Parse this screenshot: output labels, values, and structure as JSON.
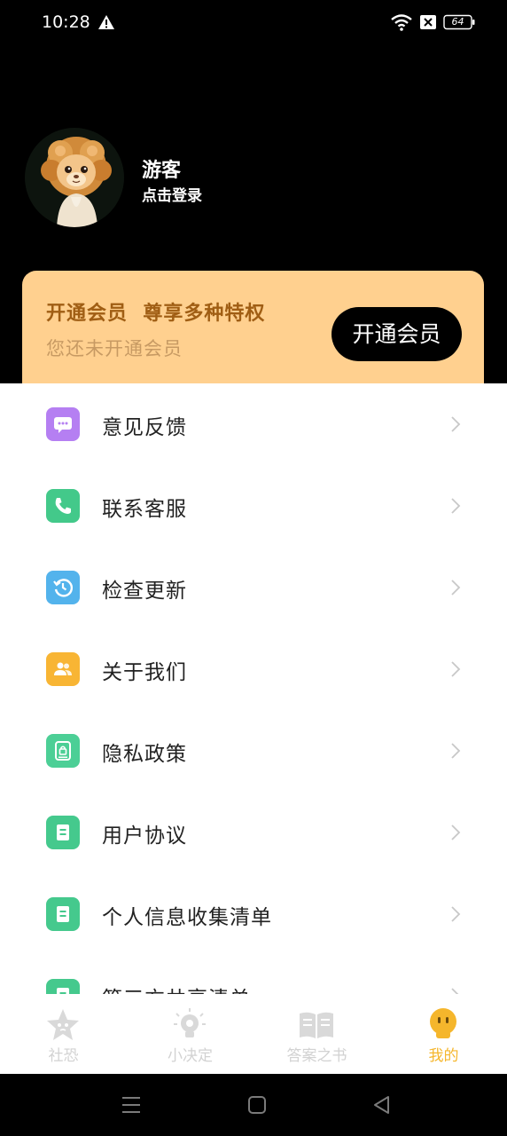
{
  "status_bar": {
    "time": "10:28",
    "battery": "64"
  },
  "profile": {
    "name": "游客",
    "login_label": "点击登录"
  },
  "vip_card": {
    "title": "开通会员  尊享多种特权",
    "subtitle": "您还未开通会员",
    "button_label": "开通会员",
    "background": "#ffd08f"
  },
  "menu": {
    "items": [
      {
        "label": "意见反馈",
        "icon": "chat-bubble-icon",
        "color": "#b57ff2"
      },
      {
        "label": "联系客服",
        "icon": "phone-icon",
        "color": "#43c98a"
      },
      {
        "label": "检查更新",
        "icon": "history-icon",
        "color": "#53b3ec"
      },
      {
        "label": "关于我们",
        "icon": "users-icon",
        "color": "#f8b534"
      },
      {
        "label": "隐私政策",
        "icon": "privacy-doc-icon",
        "color": "#4ccf96"
      },
      {
        "label": "用户协议",
        "icon": "document-icon",
        "color": "#45c98d"
      },
      {
        "label": "个人信息收集清单",
        "icon": "document-icon",
        "color": "#45c98d"
      },
      {
        "label": "第三方共享清单",
        "icon": "document-icon",
        "color": "#45c98d"
      }
    ]
  },
  "tabs": [
    {
      "label": "社恐",
      "icon": "star-face-icon",
      "active": false
    },
    {
      "label": "小决定",
      "icon": "lightbulb-icon",
      "active": false
    },
    {
      "label": "答案之书",
      "icon": "book-icon",
      "active": false
    },
    {
      "label": "我的",
      "icon": "smiley-icon",
      "active": true
    }
  ],
  "colors": {
    "accent": "#f5b62c",
    "vip_title": "#a05e14",
    "vip_sub": "#c79a63"
  }
}
